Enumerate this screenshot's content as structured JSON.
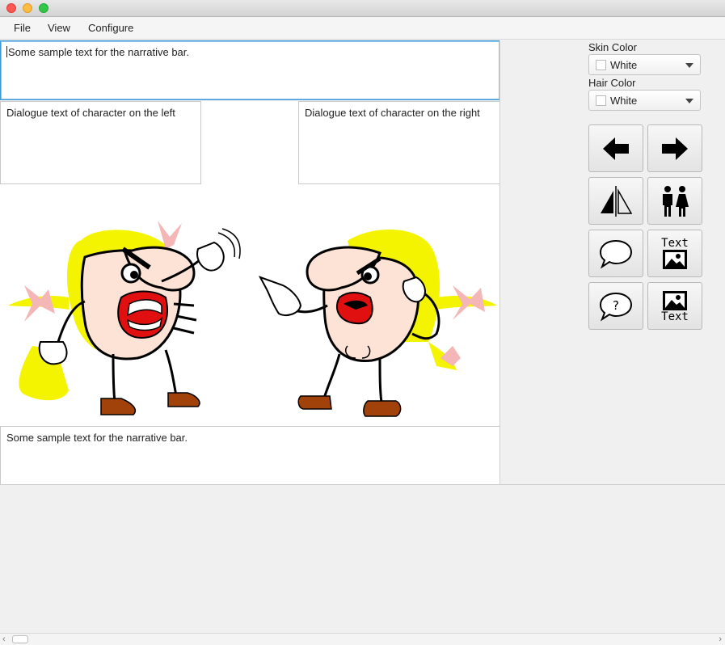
{
  "menu": {
    "file": "File",
    "view": "View",
    "configure": "Configure"
  },
  "narrative_top": "Some sample text for the narrative bar.",
  "dialogue_left": "Dialogue text of character on the left",
  "dialogue_right": "Dialogue text of character on the right",
  "narrative_bottom": "Some sample text for the narrative bar.",
  "skin": {
    "label": "Skin Color",
    "value": "White"
  },
  "hair": {
    "label": "Hair Color",
    "value": "White"
  },
  "tools": {
    "text_top_label": "Text",
    "text_bottom_label": "Text"
  },
  "colors": {
    "hair": "#f4f400",
    "skin": "#fde3d6",
    "mouth": "#e01010",
    "shoe": "#a0420a",
    "bow": "#f4b6b6",
    "focus": "#3b99d8"
  }
}
